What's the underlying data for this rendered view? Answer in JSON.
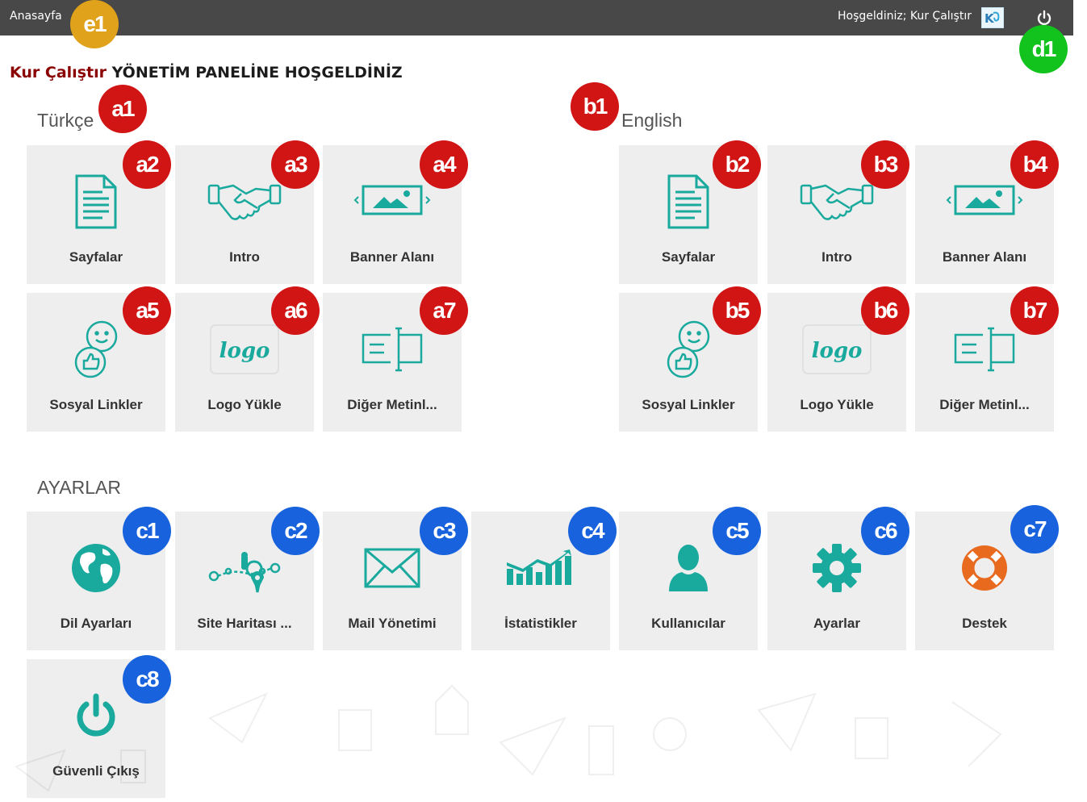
{
  "topbar": {
    "home_label": "Anasayfa",
    "welcome_text": "Hoşgeldiniz; Kur Çalıştır"
  },
  "page_title": {
    "brand": "Kur Çalıştır",
    "rest": "YÖNETİM PANELİNE HOŞGELDİNİZ"
  },
  "sections": {
    "turkce": "Türkçe",
    "english": "English",
    "ayarlar": "AYARLAR"
  },
  "turkce_tiles": [
    {
      "label": "Sayfalar",
      "icon": "document-icon"
    },
    {
      "label": "Intro",
      "icon": "handshake-icon"
    },
    {
      "label": "Banner Alanı",
      "icon": "banner-image-icon"
    },
    {
      "label": "Sosyal Linkler",
      "icon": "social-icon"
    },
    {
      "label": "Logo Yükle",
      "icon": "logo-icon"
    },
    {
      "label": "Diğer Metinl...",
      "icon": "text-field-icon"
    }
  ],
  "english_tiles": [
    {
      "label": "Sayfalar",
      "icon": "document-icon"
    },
    {
      "label": "Intro",
      "icon": "handshake-icon"
    },
    {
      "label": "Banner Alanı",
      "icon": "banner-image-icon"
    },
    {
      "label": "Sosyal Linkler",
      "icon": "social-icon"
    },
    {
      "label": "Logo Yükle",
      "icon": "logo-icon"
    },
    {
      "label": "Diğer Metinl...",
      "icon": "text-field-icon"
    }
  ],
  "settings_tiles": [
    {
      "label": "Dil Ayarları",
      "icon": "globe-icon"
    },
    {
      "label": "Site Haritası ...",
      "icon": "sitemap-icon"
    },
    {
      "label": "Mail Yönetimi",
      "icon": "mail-icon"
    },
    {
      "label": "İstatistikler",
      "icon": "chart-icon"
    },
    {
      "label": "Kullanıcılar",
      "icon": "user-icon"
    },
    {
      "label": "Ayarlar",
      "icon": "gear-icon"
    },
    {
      "label": "Destek",
      "icon": "lifebuoy-icon"
    },
    {
      "label": "Güvenli Çıkış",
      "icon": "power-icon"
    }
  ],
  "badges": {
    "e1": "e1",
    "d1": "d1",
    "a1": "a1",
    "a2": "a2",
    "a3": "a3",
    "a4": "a4",
    "a5": "a5",
    "a6": "a6",
    "a7": "a7",
    "b1": "b1",
    "b2": "b2",
    "b3": "b3",
    "b4": "b4",
    "b5": "b5",
    "b6": "b6",
    "b7": "b7",
    "c1": "c1",
    "c2": "c2",
    "c3": "c3",
    "c4": "c4",
    "c5": "c5",
    "c6": "c6",
    "c7": "c7",
    "c8": "c8"
  },
  "colors": {
    "topbar": "#484848",
    "tile_bg": "#eeeeee",
    "icon_teal": "#1aa99d",
    "brand_red": "#8b0000",
    "badge_red": "#d11414",
    "badge_blue": "#1862dd",
    "badge_green": "#12c31e",
    "badge_yellow": "#e1a21b",
    "lifebuoy_orange": "#e86a1e"
  }
}
